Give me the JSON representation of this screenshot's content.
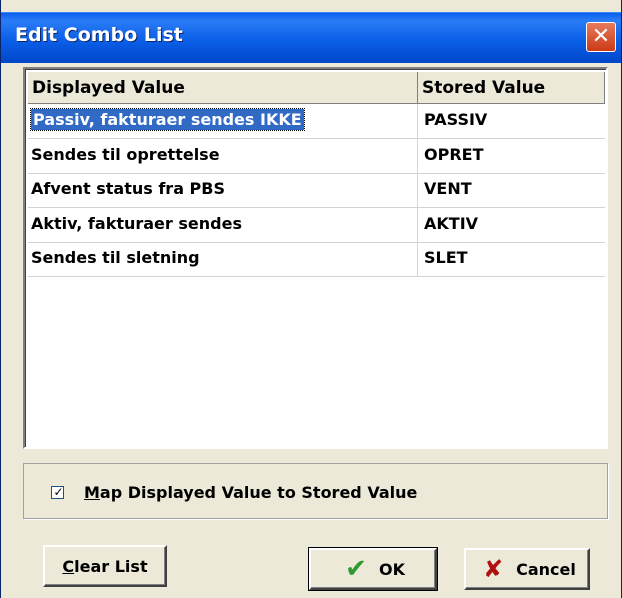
{
  "window": {
    "title": "Edit Combo List",
    "close_glyph": "✕"
  },
  "table": {
    "columns": [
      "Displayed Value",
      "Stored Value"
    ],
    "rows": [
      {
        "display": "Passiv, fakturaer sendes IKKE",
        "stored": "PASSIV",
        "selected": true
      },
      {
        "display": "Sendes til oprettelse",
        "stored": "OPRET"
      },
      {
        "display": "Afvent status fra PBS",
        "stored": "VENT"
      },
      {
        "display": "Aktiv, fakturaer sendes",
        "stored": "AKTIV"
      },
      {
        "display": "Sendes til sletning",
        "stored": "SLET"
      }
    ]
  },
  "map_checkbox": {
    "checked": true,
    "mark": "✓",
    "mnemonic": "M",
    "label_rest": "ap Displayed Value to Stored Value"
  },
  "buttons": {
    "clear": {
      "mnemonic": "C",
      "label_rest": "lear List"
    },
    "ok": {
      "label": "OK",
      "icon": "check-icon",
      "glyph": "✔"
    },
    "cancel": {
      "label": "Cancel",
      "icon": "x-icon",
      "glyph": "✘"
    }
  },
  "colors": {
    "title_bar": "#0a5ef0",
    "selection": "#316ac5",
    "ok_check": "#2f9a2f",
    "cancel_x": "#b01010"
  }
}
